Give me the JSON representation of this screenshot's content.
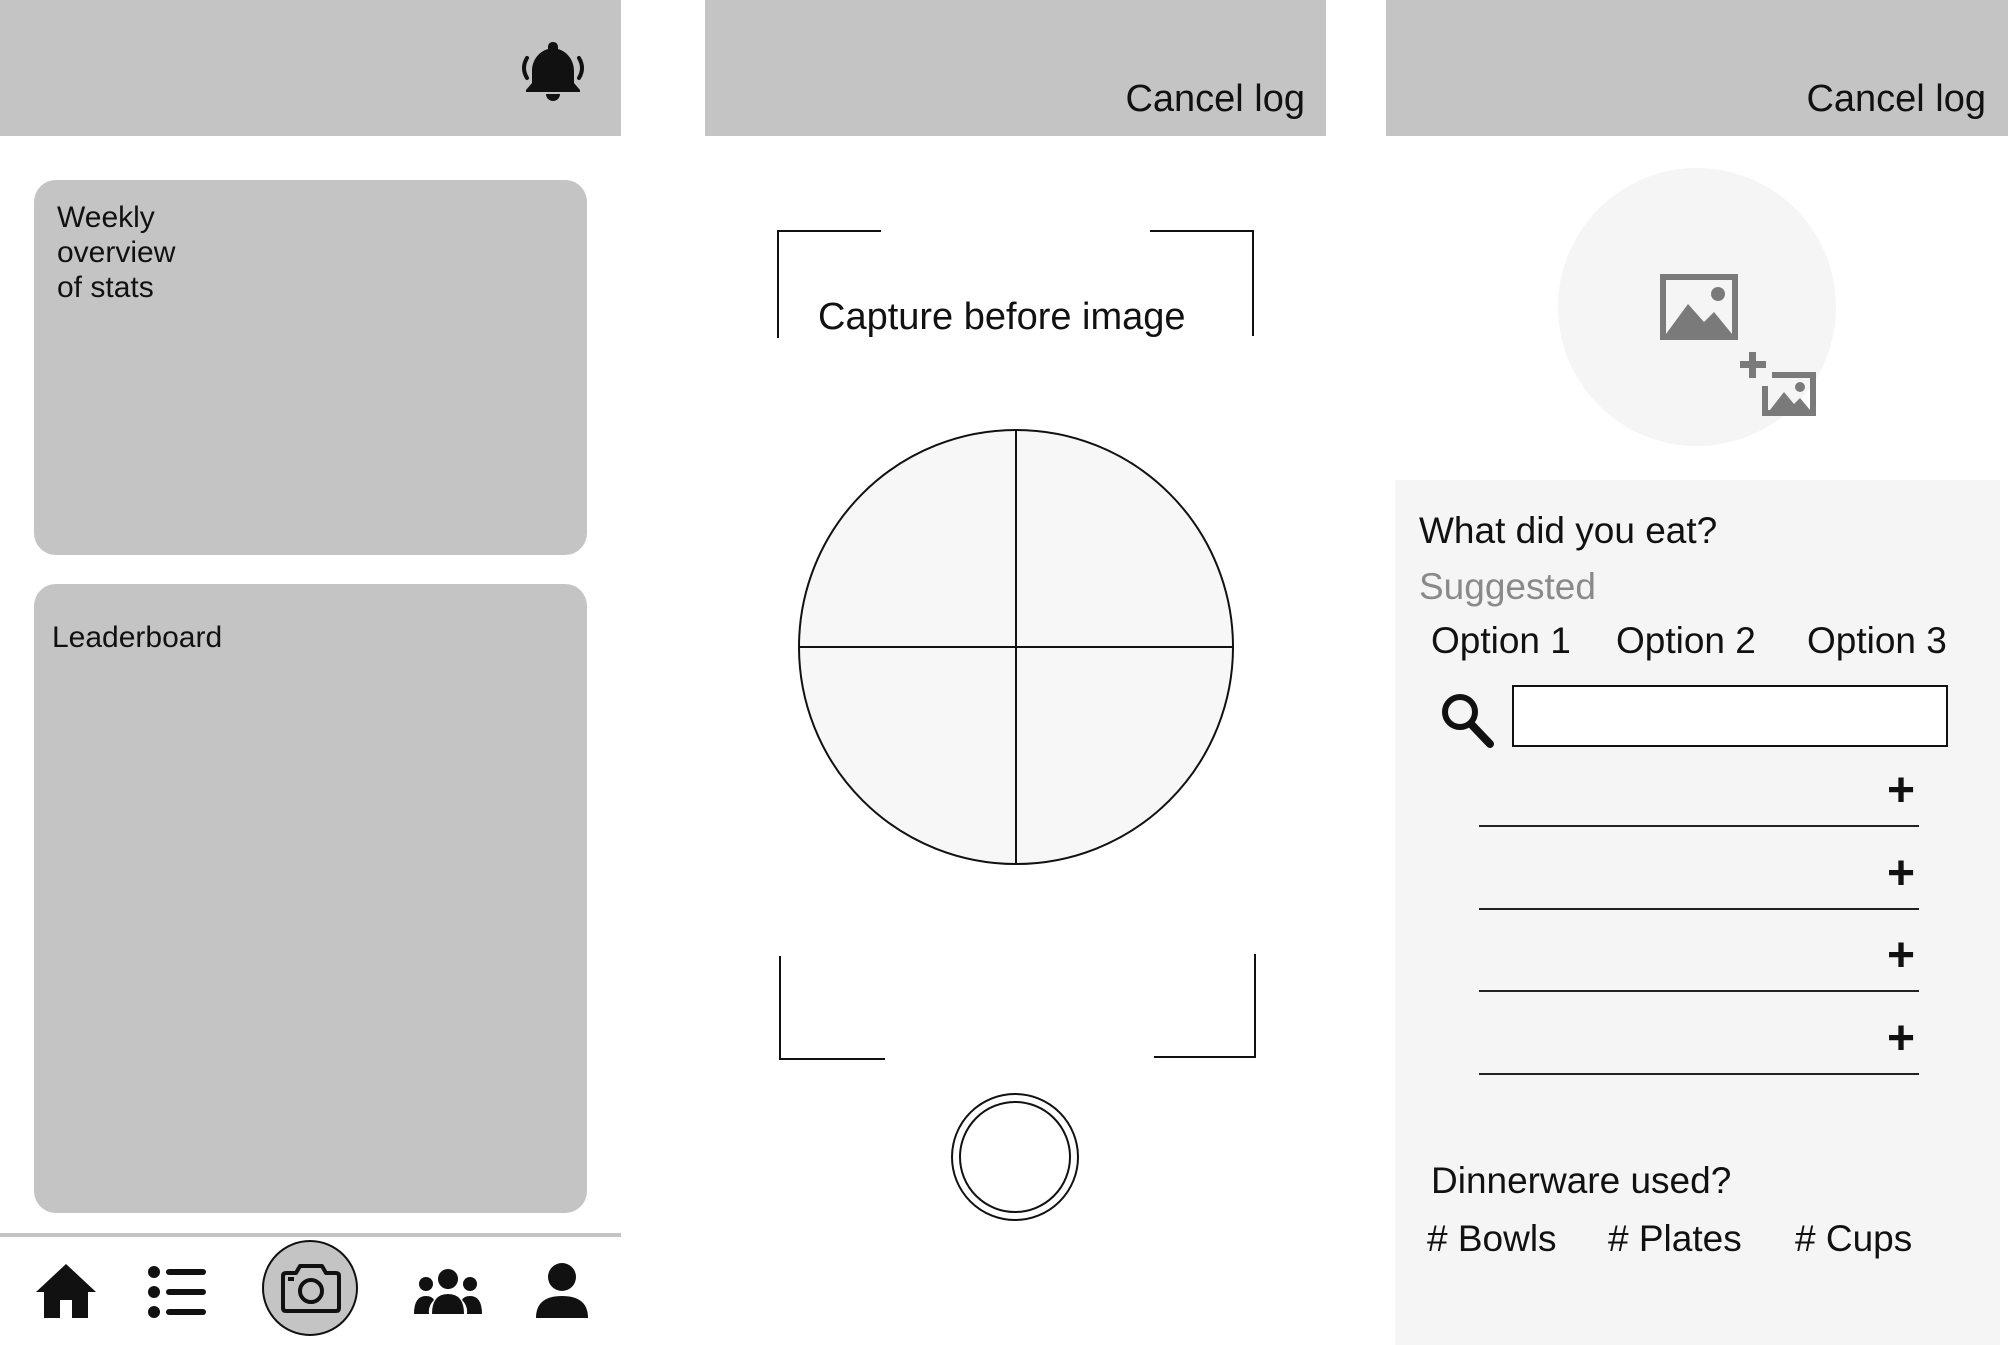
{
  "home": {
    "weekly_card": "Weekly\noverview\nof stats",
    "leaderboard_card": "Leaderboard",
    "nav": [
      "home-icon",
      "list-icon",
      "camera-icon",
      "group-icon",
      "profile-icon"
    ]
  },
  "capture": {
    "cancel_label": "Cancel log",
    "instruction": "Capture before image"
  },
  "log": {
    "cancel_label": "Cancel log",
    "question": "What did you eat?",
    "suggested_label": "Suggested",
    "options": [
      "Option 1",
      "Option 2",
      "Option 3"
    ],
    "search_placeholder": "",
    "add_rows": [
      "+",
      "+",
      "+",
      "+"
    ],
    "dinnerware_question": "Dinnerware used?",
    "dinnerware_tags": [
      "# Bowls",
      "# Plates",
      "# Cups"
    ]
  },
  "colors": {
    "header": "#c4c4c4",
    "card": "#c4c4c4",
    "panel": "#f5f5f5",
    "icon": "#111111",
    "muted": "#8a8a8a"
  }
}
